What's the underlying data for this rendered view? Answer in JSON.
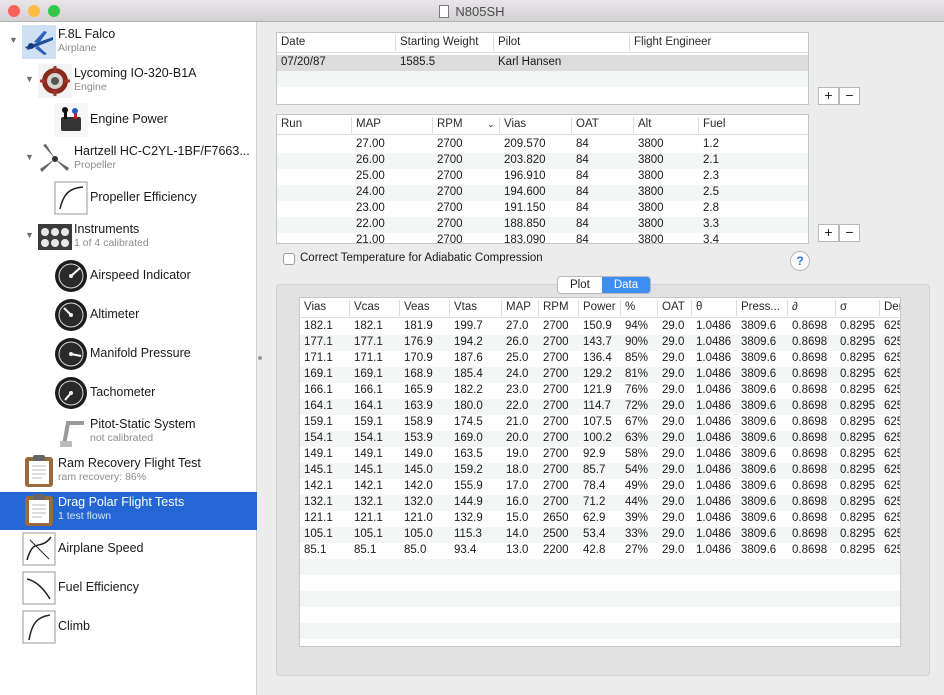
{
  "window": {
    "title": "N805SH",
    "close_color": "#fc605c",
    "min_color": "#fdbc40",
    "max_color": "#34c84a"
  },
  "sidebar": {
    "items": [
      {
        "title": "F.8L Falco",
        "subtitle": "Airplane",
        "icon": "airplane-icon",
        "expanded": true,
        "level": 0
      },
      {
        "title": "Lycoming IO-320-B1A",
        "subtitle": "Engine",
        "icon": "engine-icon",
        "expanded": true,
        "level": 1
      },
      {
        "title": "Engine Power",
        "subtitle": "",
        "icon": "engine-power-icon",
        "level": 2
      },
      {
        "title": "Hartzell HC-C2YL-1BF/F7663...",
        "subtitle": "Propeller",
        "icon": "propeller-icon",
        "expanded": true,
        "level": 1
      },
      {
        "title": "Propeller Efficiency",
        "subtitle": "",
        "icon": "curve-graph-icon",
        "level": 2
      },
      {
        "title": "Instruments",
        "subtitle": "1 of 4 calibrated",
        "icon": "instrument-panel-icon",
        "expanded": true,
        "level": 1
      },
      {
        "title": "Airspeed Indicator",
        "subtitle": "",
        "icon": "airspeed-gauge-icon",
        "level": 2
      },
      {
        "title": "Altimeter",
        "subtitle": "",
        "icon": "altimeter-gauge-icon",
        "level": 2
      },
      {
        "title": "Manifold Pressure",
        "subtitle": "",
        "icon": "manifold-gauge-icon",
        "level": 2
      },
      {
        "title": "Tachometer",
        "subtitle": "",
        "icon": "tachometer-gauge-icon",
        "level": 2
      },
      {
        "title": "Pitot-Static System",
        "subtitle": "not calibrated",
        "icon": "pitot-tube-icon",
        "level": 2
      },
      {
        "title": "Ram Recovery Flight Test",
        "subtitle": "ram recovery: 86%",
        "icon": "clipboard-icon",
        "level": 0
      },
      {
        "title": "Drag Polar Flight Tests",
        "subtitle": "1 test flown",
        "icon": "clipboard-icon",
        "level": 0,
        "selected": true
      },
      {
        "title": "Airplane Speed",
        "subtitle": "",
        "icon": "speed-graph-icon",
        "level": 0
      },
      {
        "title": "Fuel Efficiency",
        "subtitle": "",
        "icon": "fuel-graph-icon",
        "level": 0
      },
      {
        "title": "Climb",
        "subtitle": "",
        "icon": "climb-graph-icon",
        "level": 0
      }
    ]
  },
  "flights": {
    "headers": [
      "Date",
      "Starting Weight",
      "Pilot",
      "Flight Engineer"
    ],
    "rows": [
      [
        "07/20/87",
        "1585.5",
        "Karl Hansen",
        ""
      ]
    ]
  },
  "runs": {
    "headers": [
      "Run",
      "MAP",
      "RPM",
      "Vias",
      "OAT",
      "Alt",
      "Fuel"
    ],
    "rows": [
      [
        "",
        "27.00",
        "2700",
        "209.570",
        "84",
        "3800",
        "1.2"
      ],
      [
        "",
        "26.00",
        "2700",
        "203.820",
        "84",
        "3800",
        "2.1"
      ],
      [
        "",
        "25.00",
        "2700",
        "196.910",
        "84",
        "3800",
        "2.3"
      ],
      [
        "",
        "24.00",
        "2700",
        "194.600",
        "84",
        "3800",
        "2.5"
      ],
      [
        "",
        "23.00",
        "2700",
        "191.150",
        "84",
        "3800",
        "2.8"
      ],
      [
        "",
        "22.00",
        "2700",
        "188.850",
        "84",
        "3800",
        "3.3"
      ],
      [
        "",
        "21.00",
        "2700",
        "183.090",
        "84",
        "3800",
        "3.4"
      ]
    ]
  },
  "buttons": {
    "add": "+",
    "remove": "−",
    "help": "?"
  },
  "checkbox": {
    "label": "Correct Temperature for Adiabatic Compression",
    "checked": false
  },
  "tabs": [
    "Plot",
    "Data"
  ],
  "data": {
    "headers": [
      "Vias",
      "Vcas",
      "Veas",
      "Vtas",
      "MAP",
      "RPM",
      "Power",
      "%",
      "OAT",
      "θ",
      "Press...",
      "∂",
      "σ",
      "Den"
    ],
    "rows": [
      [
        "182.1",
        "182.1",
        "181.9",
        "199.7",
        "27.0",
        "2700",
        "150.9",
        "94%",
        "29.0",
        "1.0486",
        "3809.6",
        "0.8698",
        "0.8295",
        "625"
      ],
      [
        "177.1",
        "177.1",
        "176.9",
        "194.2",
        "26.0",
        "2700",
        "143.7",
        "90%",
        "29.0",
        "1.0486",
        "3809.6",
        "0.8698",
        "0.8295",
        "625"
      ],
      [
        "171.1",
        "171.1",
        "170.9",
        "187.6",
        "25.0",
        "2700",
        "136.4",
        "85%",
        "29.0",
        "1.0486",
        "3809.6",
        "0.8698",
        "0.8295",
        "625"
      ],
      [
        "169.1",
        "169.1",
        "168.9",
        "185.4",
        "24.0",
        "2700",
        "129.2",
        "81%",
        "29.0",
        "1.0486",
        "3809.6",
        "0.8698",
        "0.8295",
        "625"
      ],
      [
        "166.1",
        "166.1",
        "165.9",
        "182.2",
        "23.0",
        "2700",
        "121.9",
        "76%",
        "29.0",
        "1.0486",
        "3809.6",
        "0.8698",
        "0.8295",
        "625"
      ],
      [
        "164.1",
        "164.1",
        "163.9",
        "180.0",
        "22.0",
        "2700",
        "114.7",
        "72%",
        "29.0",
        "1.0486",
        "3809.6",
        "0.8698",
        "0.8295",
        "625"
      ],
      [
        "159.1",
        "159.1",
        "158.9",
        "174.5",
        "21.0",
        "2700",
        "107.5",
        "67%",
        "29.0",
        "1.0486",
        "3809.6",
        "0.8698",
        "0.8295",
        "625"
      ],
      [
        "154.1",
        "154.1",
        "153.9",
        "169.0",
        "20.0",
        "2700",
        "100.2",
        "63%",
        "29.0",
        "1.0486",
        "3809.6",
        "0.8698",
        "0.8295",
        "625"
      ],
      [
        "149.1",
        "149.1",
        "149.0",
        "163.5",
        "19.0",
        "2700",
        "92.9",
        "58%",
        "29.0",
        "1.0486",
        "3809.6",
        "0.8698",
        "0.8295",
        "625"
      ],
      [
        "145.1",
        "145.1",
        "145.0",
        "159.2",
        "18.0",
        "2700",
        "85.7",
        "54%",
        "29.0",
        "1.0486",
        "3809.6",
        "0.8698",
        "0.8295",
        "625"
      ],
      [
        "142.1",
        "142.1",
        "142.0",
        "155.9",
        "17.0",
        "2700",
        "78.4",
        "49%",
        "29.0",
        "1.0486",
        "3809.6",
        "0.8698",
        "0.8295",
        "625"
      ],
      [
        "132.1",
        "132.1",
        "132.0",
        "144.9",
        "16.0",
        "2700",
        "71.2",
        "44%",
        "29.0",
        "1.0486",
        "3809.6",
        "0.8698",
        "0.8295",
        "625"
      ],
      [
        "121.1",
        "121.1",
        "121.0",
        "132.9",
        "15.0",
        "2650",
        "62.9",
        "39%",
        "29.0",
        "1.0486",
        "3809.6",
        "0.8698",
        "0.8295",
        "625"
      ],
      [
        "105.1",
        "105.1",
        "105.0",
        "115.3",
        "14.0",
        "2500",
        "53.4",
        "33%",
        "29.0",
        "1.0486",
        "3809.6",
        "0.8698",
        "0.8295",
        "625"
      ],
      [
        "85.1",
        "85.1",
        "85.0",
        "93.4",
        "13.0",
        "2200",
        "42.8",
        "27%",
        "29.0",
        "1.0486",
        "3809.6",
        "0.8698",
        "0.8295",
        "625"
      ]
    ]
  }
}
